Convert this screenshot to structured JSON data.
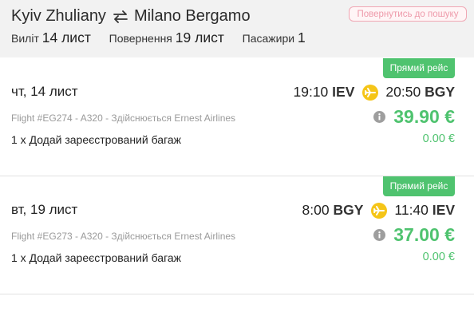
{
  "header": {
    "origin": "Kyiv Zhuliany",
    "destination": "Milano Bergamo",
    "back_button": "Повернутись до пошуку",
    "departure_label": "Виліт",
    "departure_value": "14 лист",
    "return_label": "Повернення",
    "return_value": "19 лист",
    "passengers_label": "Пасажири",
    "passengers_value": "1"
  },
  "flights": [
    {
      "badge": "Прямий рейс",
      "date": "чт, 14 лист",
      "dep_time": "19:10",
      "dep_code": "IEV",
      "arr_time": "20:50",
      "arr_code": "BGY",
      "flight_info": "Flight #EG274 - A320 - Здійснюється Ernest Airlines",
      "price": "39.90 €",
      "baggage": "1 x Додай зареєстрований багаж",
      "baggage_price": "0.00 €"
    },
    {
      "badge": "Прямий рейс",
      "date": "вт, 19 лист",
      "dep_time": "8:00",
      "dep_code": "BGY",
      "arr_time": "11:40",
      "arr_code": "IEV",
      "flight_info": "Flight #EG273 - A320 - Здійснюється Ernest Airlines",
      "price": "37.00 €",
      "baggage": "1 x Додай зареєстрований багаж",
      "baggage_price": "0.00 €"
    }
  ],
  "icons": {
    "swap": "swap-arrows-icon",
    "plane": "airplane-icon",
    "info": "info-icon"
  },
  "colors": {
    "accent_green": "#4fc36f",
    "plane_yellow": "#f5c518",
    "back_button_pink": "#ee9aaa",
    "header_bg": "#f2f2f2"
  }
}
